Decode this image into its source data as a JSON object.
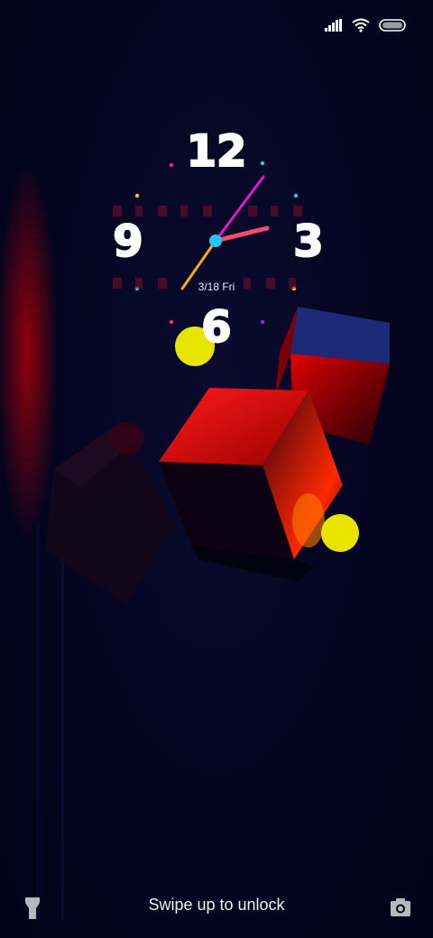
{
  "status_bar": {
    "icons": [
      "signal-icon",
      "wifi-icon",
      "battery-icon"
    ]
  },
  "clock": {
    "numerals": {
      "twelve": "12",
      "three": "3",
      "six": "6",
      "nine": "9"
    },
    "date": "3/18 Fri",
    "hand_colors": {
      "hour": "#f24e6b",
      "minute": "#e01ad0",
      "second": "#f7a61d",
      "center": "#1ec8ff"
    }
  },
  "wallpaper": {
    "accent_colors": [
      "#d40000",
      "#e8e400",
      "#1a2a7a"
    ]
  },
  "lockscreen": {
    "swipe_text": "Swipe up to unlock",
    "left_button_icon": "flashlight-icon",
    "right_button_icon": "camera-icon"
  }
}
